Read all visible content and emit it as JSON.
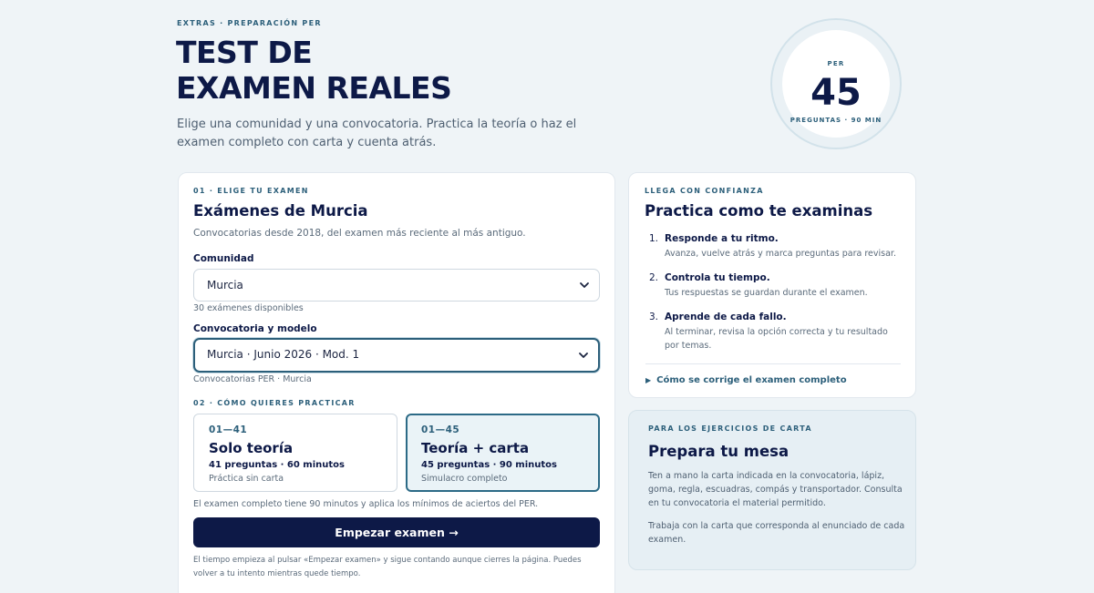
{
  "hero": {
    "eyebrow": "EXTRAS · PREPARACIÓN PER",
    "title_line1": "TEST DE",
    "title_line2": "EXAMEN REALES",
    "lead": "Elige una comunidad y una convocatoria. Practica la teoría o haz el examen completo con carta y cuenta atrás."
  },
  "badge": {
    "label": "PER",
    "number": "45",
    "sub": "PREGUNTAS · 90 MIN"
  },
  "exam_card": {
    "eyebrow": "01 · ELIGE TU EXAMEN",
    "title": "Exámenes de Murcia",
    "subtitle": "Convocatorias desde 2018, del examen más reciente al más antiguo.",
    "community_label": "Comunidad",
    "community_value": "Murcia",
    "community_hint": "30 exámenes disponibles",
    "session_label": "Convocatoria y modelo",
    "session_value": "Murcia · Junio 2026 · Mod. 1",
    "session_hint": "Convocatorias PER · Murcia",
    "practice_eyebrow": "02 · CÓMO QUIERES PRACTICAR",
    "modes": [
      {
        "range": "01—41",
        "title": "Solo teoría",
        "detail": "41 preguntas · 60 minutos",
        "note": "Práctica sin carta"
      },
      {
        "range": "01—45",
        "title": "Teoría + carta",
        "detail": "45 preguntas · 90 minutos",
        "note": "Simulacro completo"
      }
    ],
    "full_exam_note": "El examen completo tiene 90 minutos y aplica los mínimos de aciertos del PER.",
    "start_label": "Empezar examen →",
    "timer_note": "El tiempo empieza al pulsar «Empezar examen» y sigue contando aunque cierres la página. Puedes volver a tu intento mientras quede tiempo."
  },
  "confidence_card": {
    "eyebrow": "LLEGA CON CONFIANZA",
    "title": "Practica como te examinas",
    "steps": [
      {
        "num": "1.",
        "title": "Responde a tu ritmo.",
        "desc": "Avanza, vuelve atrás y marca preguntas para revisar."
      },
      {
        "num": "2.",
        "title": "Controla tu tiempo.",
        "desc": "Tus respuestas se guardan durante el examen."
      },
      {
        "num": "3.",
        "title": "Aprende de cada fallo.",
        "desc": "Al terminar, revisa la opción correcta y tu resultado por temas."
      }
    ],
    "details_label": "Cómo se corrige el examen completo"
  },
  "table_card": {
    "eyebrow": "PARA LOS EJERCICIOS DE CARTA",
    "title": "Prepara tu mesa",
    "para1": "Ten a mano la carta indicada en la convocatoria, lápiz, goma, regla, escuadras, compás y transportador. Consulta en tu convocatoria el material permitido.",
    "para2": "Trabaja con la carta que corresponda al enunciado de cada examen."
  }
}
